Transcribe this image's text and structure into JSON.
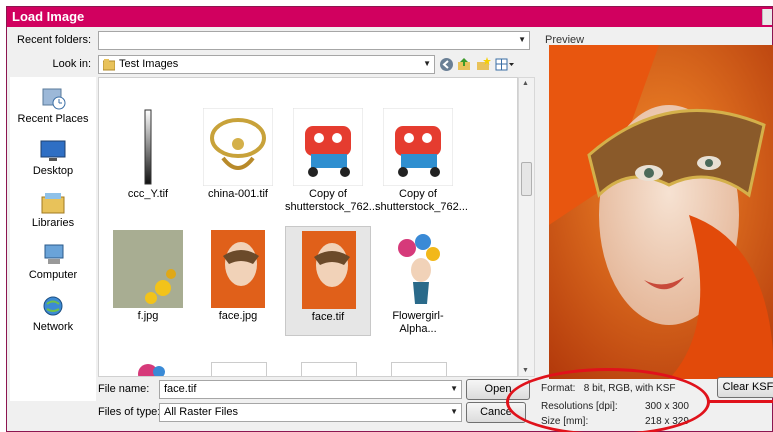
{
  "window": {
    "title": "Load Image"
  },
  "recent_folders": {
    "label": "Recent folders:",
    "value": ""
  },
  "look_in": {
    "label": "Look in:",
    "value": "Test Images"
  },
  "places": [
    {
      "label": "Recent Places",
      "icon": "recent-places-icon"
    },
    {
      "label": "Desktop",
      "icon": "desktop-icon"
    },
    {
      "label": "Libraries",
      "icon": "libraries-icon"
    },
    {
      "label": "Computer",
      "icon": "computer-icon"
    },
    {
      "label": "Network",
      "icon": "network-icon"
    }
  ],
  "files": [
    {
      "name": "ccc_Y.tif",
      "thumb": "gradient-strip"
    },
    {
      "name": "china-001.tif",
      "thumb": "dragon"
    },
    {
      "name": "Copy of shutterstock_762...",
      "thumb": "lion-toy"
    },
    {
      "name": "Copy of shutterstock_762...",
      "thumb": "lion-toy"
    },
    {
      "name": "f.jpg",
      "thumb": "floral-frame"
    },
    {
      "name": "face.jpg",
      "thumb": "mask-face"
    },
    {
      "name": "face.tif",
      "thumb": "mask-face",
      "selected": true
    },
    {
      "name": "Flowergirl-Alpha...",
      "thumb": "flower-girl"
    }
  ],
  "file_name": {
    "label": "File name:",
    "value": "face.tif"
  },
  "file_type": {
    "label": "Files of type:",
    "value": "All Raster Files"
  },
  "buttons": {
    "open": "Open",
    "cancel": "Cance",
    "clear_ksf": "Clear KSF"
  },
  "preview": {
    "label": "Preview"
  },
  "info": {
    "format_label": "Format:",
    "format_value": "8 bit, RGB, with KSF",
    "resolution_label": "Resolutions [dpi]:",
    "resolution_value": "300 x 300",
    "size_label": "Size [mm]:",
    "size_value": "218 x 329"
  },
  "colors": {
    "titlebar": "#d1005f",
    "annotation": "#e0121b"
  }
}
